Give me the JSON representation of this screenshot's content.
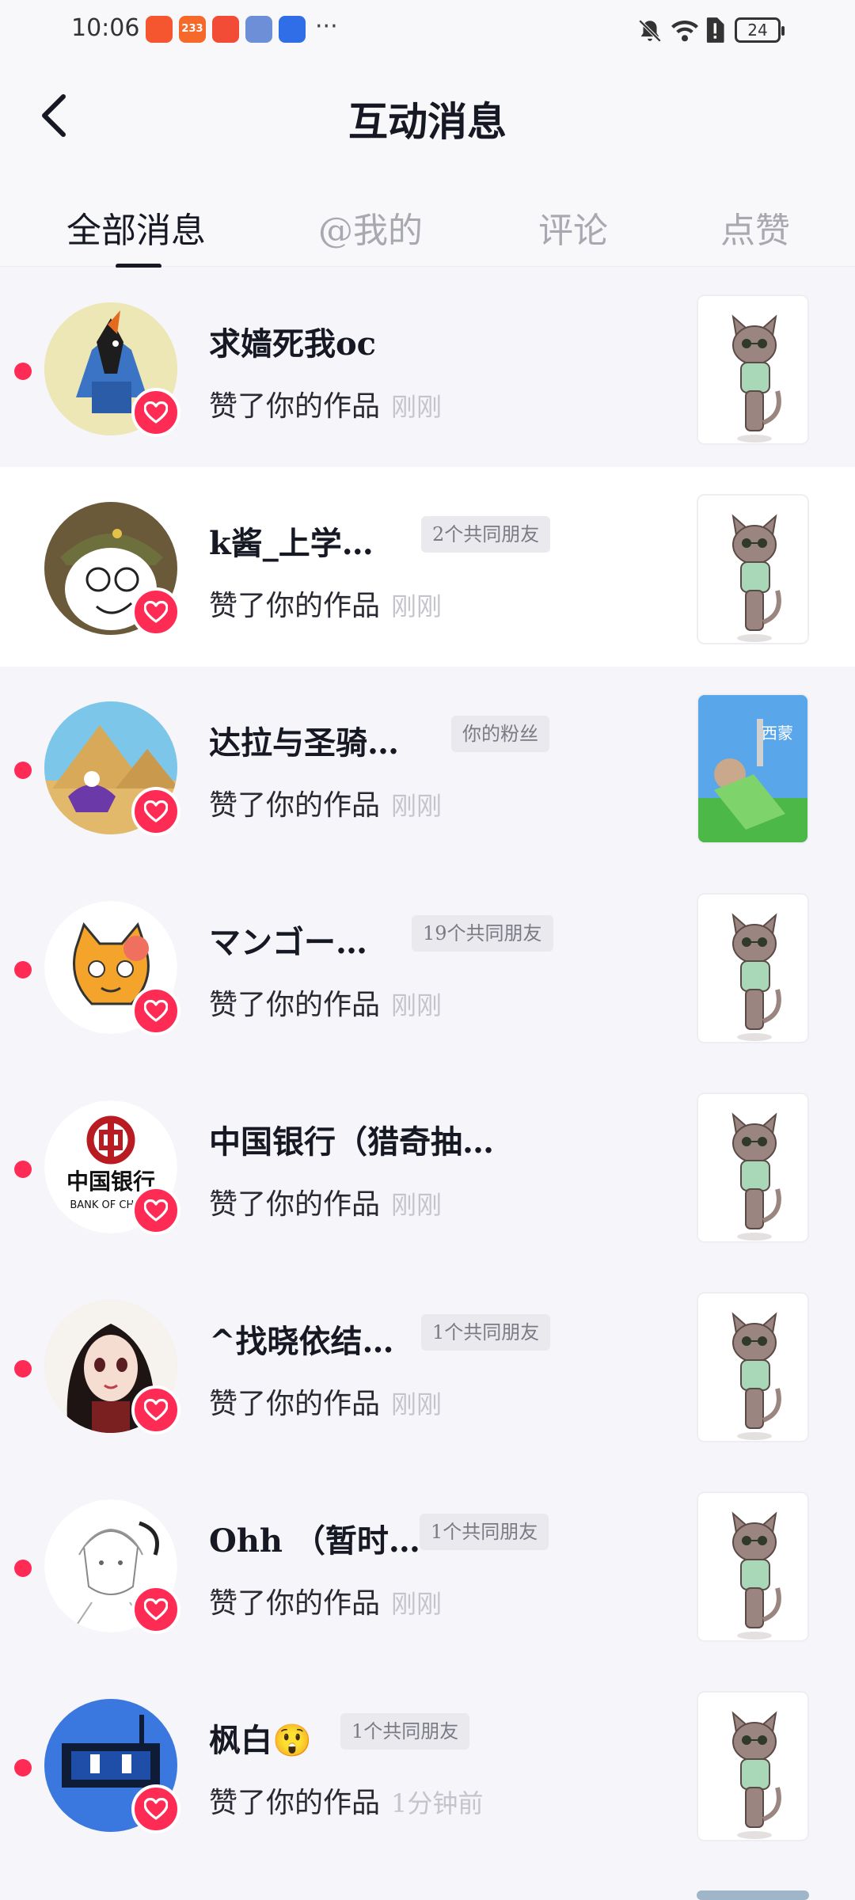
{
  "status_bar": {
    "time": "10:06",
    "apps": [
      {
        "icon": "weibo-app-icon",
        "label": "",
        "color": "#f5562f"
      },
      {
        "icon": "233-app-icon",
        "label": "233",
        "color": "#f56a2a"
      },
      {
        "icon": "taobao-app-icon",
        "label": "",
        "color": "#f24b36"
      },
      {
        "icon": "game-app-icon",
        "label": "",
        "color": "#6c8fd8"
      },
      {
        "icon": "baidu-app-icon",
        "label": "",
        "color": "#2f6ee6"
      }
    ],
    "more": "···",
    "battery": "24"
  },
  "header": {
    "title": "互动消息"
  },
  "tabs": [
    {
      "label": "全部消息",
      "active": true
    },
    {
      "label": "@我的",
      "active": false
    },
    {
      "label": "评论",
      "active": false
    },
    {
      "label": "点赞",
      "active": false
    }
  ],
  "notifications": [
    {
      "name": "求嫱死我oc",
      "tag": "",
      "action": "赞了你的作品",
      "time": "刚刚",
      "avatar": "bird-avatar",
      "thumb": "cat-sticker-thumbnail"
    },
    {
      "name": "k酱_上学…",
      "tag": "2个共同朋友",
      "action": "赞了你的作品",
      "time": "刚刚",
      "avatar": "cartoon-officer-avatar",
      "thumb": "cat-sticker-thumbnail"
    },
    {
      "name": "达拉与圣骑…",
      "tag": "你的粉丝",
      "action": "赞了你的作品",
      "time": "刚刚",
      "avatar": "pyramid-avatar",
      "thumb": "game-scene-thumbnail",
      "thumb_text": "西蒙"
    },
    {
      "name": "マンゴー…",
      "tag": "19个共同朋友",
      "action": "赞了你的作品",
      "time": "刚刚",
      "avatar": "orange-cat-avatar",
      "thumb": "cat-sticker-thumbnail"
    },
    {
      "name": "中国银行（猎奇抽…",
      "tag": "",
      "action": "赞了你的作品",
      "time": "刚刚",
      "avatar": "bank-of-china-avatar",
      "avatar_text": [
        "中国银行",
        "BANK OF CHINA"
      ],
      "thumb": "cat-sticker-thumbnail"
    },
    {
      "name": "^找晓依结…",
      "tag": "1个共同朋友",
      "action": "赞了你的作品",
      "time": "刚刚",
      "avatar": "anime-girl-avatar",
      "thumb": "cat-sticker-thumbnail"
    },
    {
      "name": "Ohh （暂时…",
      "tag": "1个共同朋友",
      "action": "赞了你的作品",
      "time": "刚刚",
      "avatar": "sketch-avatar",
      "thumb": "cat-sticker-thumbnail"
    },
    {
      "name": "枫白😲",
      "tag": "1个共同朋友",
      "action": "赞了你的作品",
      "time": "1分钟前",
      "avatar": "robot-avatar",
      "thumb": "cat-sticker-thumbnail"
    }
  ],
  "colors": {
    "accent": "#fe2c55",
    "background": "#f6f5f9",
    "text": "#161823",
    "muted": "#a8a8b0"
  }
}
